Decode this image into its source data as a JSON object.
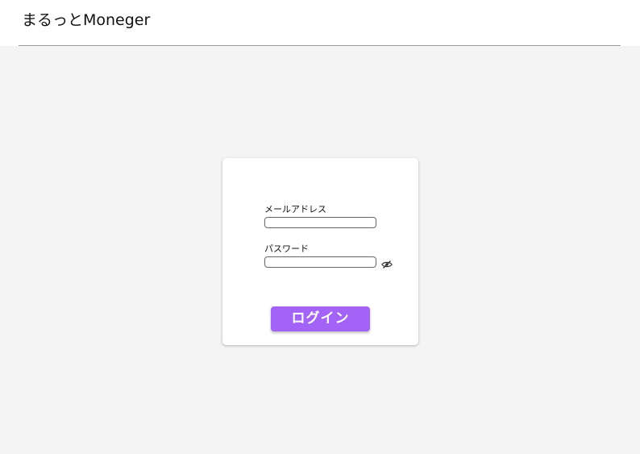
{
  "header": {
    "title": "まるっとMoneger"
  },
  "login_form": {
    "email": {
      "label": "メールアドレス",
      "value": ""
    },
    "password": {
      "label": "パスワード",
      "value": "",
      "visibility_icon": "eye-off-icon"
    },
    "submit_label": "ログイン"
  },
  "colors": {
    "page_background": "#f4f4f4",
    "button_accent": "#a463f7"
  }
}
